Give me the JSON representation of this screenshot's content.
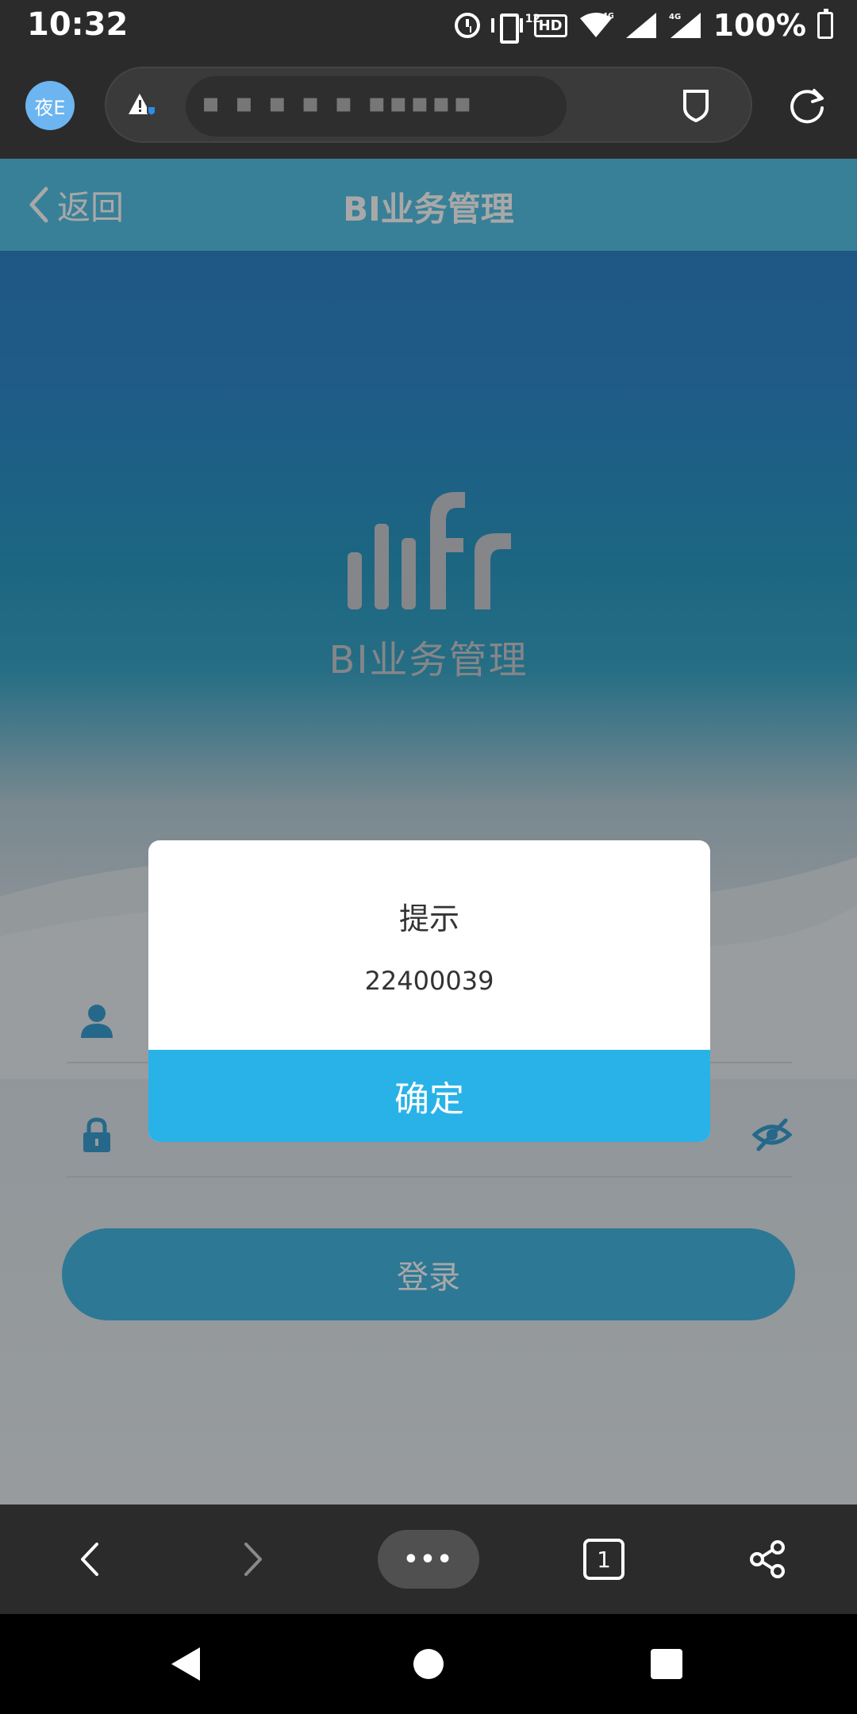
{
  "status_bar": {
    "time": "10:32",
    "hd_label": "HD",
    "hd_sub": "12",
    "network_label": "4G",
    "network_label_2": "4G",
    "battery": "100%"
  },
  "browser": {
    "avatar_label": "夜E",
    "url_text": "▪ ▪    ▪ ▪ ▪ ▪▪▪▪▪"
  },
  "nav": {
    "back_label": "返回",
    "title": "BI业务管理"
  },
  "logo": {
    "caption": "BI业务管理"
  },
  "form": {
    "username_value": "·",
    "password_value": "•••••",
    "login_label": "登录"
  },
  "dialog": {
    "title": "提示",
    "message": "22400039",
    "ok_label": "确定"
  },
  "toolbar": {
    "menu_label": "•••",
    "tab_count": "1"
  },
  "colors": {
    "nav_bar": "#55c2e6",
    "dialog_button": "#28b2e8",
    "login_button": "#45b7e3"
  }
}
